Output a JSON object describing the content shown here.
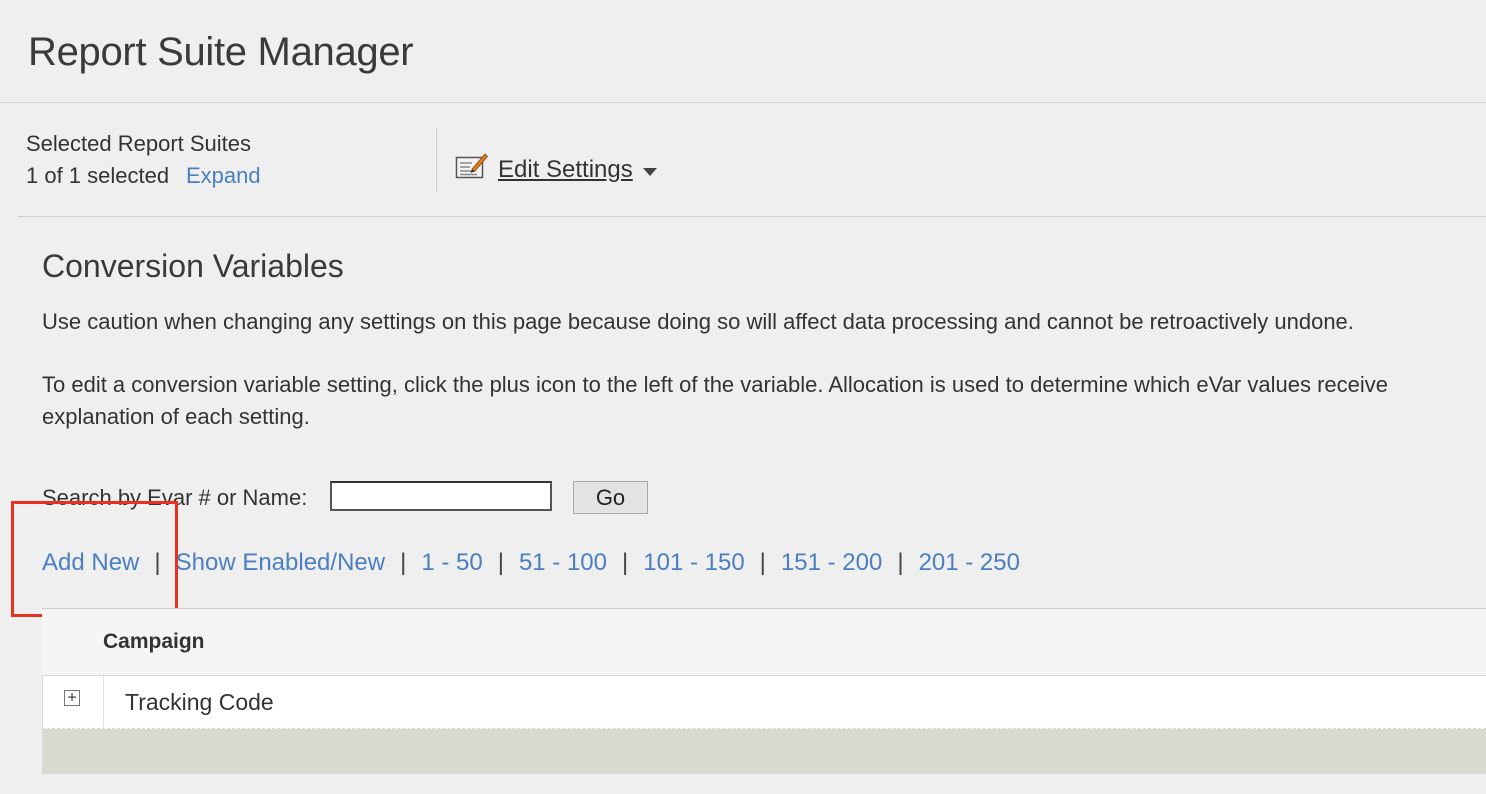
{
  "page": {
    "title": "Report Suite Manager"
  },
  "toolbar": {
    "selected_label": "Selected Report Suites",
    "selected_count": "1 of 1 selected",
    "expand_label": "Expand",
    "edit_settings_label": "Edit Settings",
    "edit_settings_icon": "edit-document-icon",
    "dropdown_icon": "caret-down-icon"
  },
  "section": {
    "title": "Conversion Variables",
    "caution_text": "Use caution when changing any settings on this page because doing so will affect data processing and cannot be retroactively undone.",
    "instructions_line1": "To edit a conversion variable setting, click the plus icon to the left of the variable. Allocation is used to determine which eVar values receive",
    "instructions_line2": "explanation of each setting."
  },
  "search": {
    "label": "Search by Evar # or Name:",
    "value": "",
    "placeholder": "",
    "go_label": "Go"
  },
  "nav": {
    "add_new": "Add New",
    "separator": "|",
    "show_enabled": "Show Enabled/New",
    "ranges": [
      "1 - 50",
      "51 - 100",
      "101 - 150",
      "151 - 200",
      "201 - 250"
    ]
  },
  "table": {
    "header": "Campaign",
    "rows": [
      {
        "name": "Tracking Code",
        "expand_icon": "plus-box-icon"
      }
    ]
  },
  "colors": {
    "link": "#4a7fc1",
    "highlight": "#e8321f",
    "background": "#efefef"
  }
}
